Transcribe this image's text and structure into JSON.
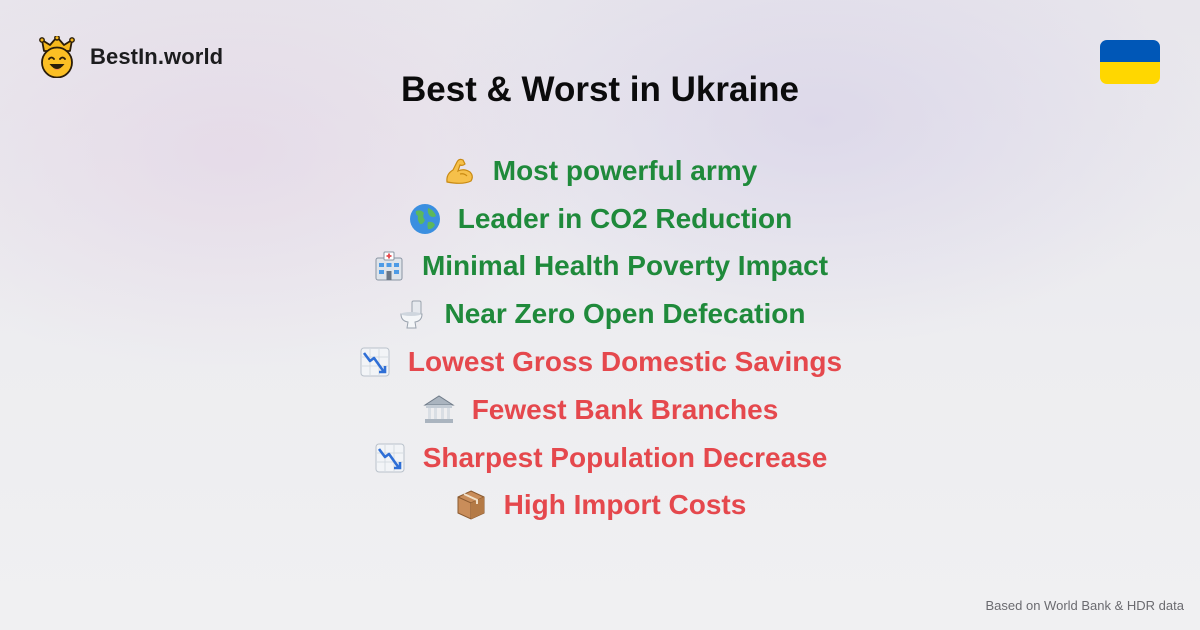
{
  "brand": {
    "name": "BestIn.world",
    "logo_icon": "crowned-smiley-icon"
  },
  "flag": {
    "country": "Ukraine",
    "colors": [
      "#0057b7",
      "#ffd700"
    ]
  },
  "title": "Best & Worst in Ukraine",
  "colors": {
    "good": "#1f8a3b",
    "bad": "#e5484d"
  },
  "items": [
    {
      "label": "Most powerful army",
      "icon": "flexed-biceps-icon",
      "kind": "good"
    },
    {
      "label": "Leader in CO2 Reduction",
      "icon": "globe-icon",
      "kind": "good"
    },
    {
      "label": "Minimal Health Poverty Impact",
      "icon": "hospital-icon",
      "kind": "good"
    },
    {
      "label": "Near Zero Open Defecation",
      "icon": "toilet-icon",
      "kind": "good"
    },
    {
      "label": "Lowest Gross Domestic Savings",
      "icon": "chart-decreasing-icon",
      "kind": "bad"
    },
    {
      "label": "Fewest Bank Branches",
      "icon": "bank-icon",
      "kind": "bad"
    },
    {
      "label": "Sharpest Population Decrease",
      "icon": "chart-decreasing-icon",
      "kind": "bad"
    },
    {
      "label": "High Import Costs",
      "icon": "package-icon",
      "kind": "bad"
    }
  ],
  "footer": "Based on World Bank & HDR data"
}
